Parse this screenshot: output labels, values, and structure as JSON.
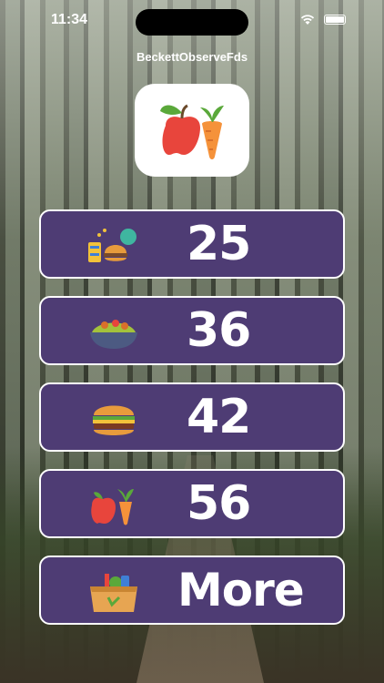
{
  "status_bar": {
    "time": "11:34"
  },
  "app": {
    "title": "BeckettObserveFds"
  },
  "menu": {
    "items": [
      {
        "label": "25",
        "icon": "food-combo-icon"
      },
      {
        "label": "36",
        "icon": "salad-bowl-icon"
      },
      {
        "label": "42",
        "icon": "burger-icon"
      },
      {
        "label": "56",
        "icon": "apple-carrot-icon"
      },
      {
        "label": "More",
        "icon": "grocery-box-icon"
      }
    ]
  },
  "colors": {
    "button_bg": "#4e3c74",
    "button_border": "#ffffff"
  }
}
